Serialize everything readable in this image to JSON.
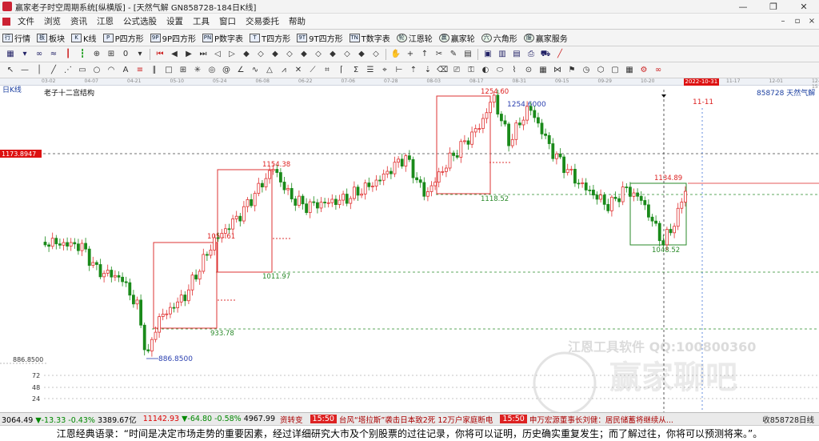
{
  "window": {
    "title": "赢家老子时空周期系统[纵横版] - [天然气解  GN858728-184日K线]"
  },
  "menu": [
    "文件",
    "浏览",
    "资讯",
    "江恩",
    "公式选股",
    "设置",
    "工具",
    "窗口",
    "交易委托",
    "帮助"
  ],
  "toolbar": [
    {
      "icon": "行",
      "label": "行情"
    },
    {
      "icon": "板",
      "label": "板块"
    },
    {
      "icon": "K",
      "label": "K线"
    },
    {
      "icon": "P",
      "label": "P四方形"
    },
    {
      "icon": "9P",
      "label": "9P四方形"
    },
    {
      "icon": "PN",
      "label": "P数字表"
    },
    {
      "icon": "T",
      "label": "T四方形"
    },
    {
      "icon": "9T",
      "label": "9T四方形"
    },
    {
      "icon": "TN",
      "label": "T数字表"
    },
    {
      "icon": "轮",
      "label": "江恩轮"
    },
    {
      "icon": "赢",
      "label": "赢家轮"
    },
    {
      "icon": "六",
      "label": "六角形"
    },
    {
      "icon": "服",
      "label": "赢家服务"
    }
  ],
  "dates": [
    "03-02",
    "04-07",
    "04-21",
    "05-10",
    "05-24",
    "06-08",
    "06-22",
    "07-06",
    "07-28",
    "08-03",
    "08-17",
    "08-31",
    "09-15",
    "09-29",
    "10-20",
    "2022-10-31",
    "11-17",
    "12-01",
    "12-15"
  ],
  "chart": {
    "period_label": "日K线",
    "study_name": "老子十二宫结构",
    "symbol_label": "858728 天然气解",
    "date_marker": "11-11",
    "price_tag": "1173.8947",
    "axis_low_label": "886.8500",
    "vol_ticks": [
      "72",
      "48",
      "24"
    ],
    "low_marker": "886.8500",
    "high_marker": "1254.6000"
  },
  "chart_data": {
    "type": "candlestick",
    "title": "老子十二宫结构",
    "x": [
      "03-02",
      "04-07",
      "04-21",
      "05-10",
      "05-24",
      "06-08",
      "06-22",
      "07-06",
      "07-28",
      "08-03",
      "08-17",
      "08-31",
      "09-15",
      "09-29",
      "10-20",
      "2022-10-31",
      "11-17",
      "12-01",
      "12-15"
    ],
    "annotations": [
      {
        "label": "1154.38",
        "value": 1154.38
      },
      {
        "label": "1054.61",
        "value": 1054.61
      },
      {
        "label": "1011.97",
        "value": 1011.97
      },
      {
        "label": "933.78",
        "value": 933.78
      },
      {
        "label": "1254.60",
        "value": 1254.6
      },
      {
        "label": "1118.52",
        "value": 1118.52
      },
      {
        "label": "1134.89",
        "value": 1134.89
      },
      {
        "label": "1048.52",
        "value": 1048.52
      }
    ],
    "reference_lines": [
      1173.8947,
      1118.52,
      1011.97,
      933.78
    ],
    "ylim": [
      886.85,
      1254.6
    ],
    "colors": {
      "up": "#e03030",
      "down": "#1a8a1a"
    }
  },
  "watermark": {
    "brand": "江恩工具软件  QQ:100800360",
    "logo_text": "赢家聊吧"
  },
  "status": {
    "idx1": {
      "value": "3064.49",
      "change": "▼-13.33",
      "pct": "-0.43%",
      "amount": "3389.67亿"
    },
    "idx2": {
      "value": "11142.93",
      "change": "▼-64.80",
      "pct": "-0.58%",
      "amount": "4967.99"
    },
    "news_prefix": "资转变",
    "news1_time": "15:50",
    "news1": "台风“塔拉斯”袭击日本致2死 12万户家庭断电",
    "news2_time": "15:50",
    "news2": "申万宏源董事长刘健：居民储蓄将继续从...",
    "right": "收858728日线"
  },
  "quote": "江恩经典语录：“时间是决定市场走势的重要因素，经过详细研究大市及个别股票的过往记录，你将可以证明，历史确实重复发生；而了解过往，你将可以预测将来。”。"
}
